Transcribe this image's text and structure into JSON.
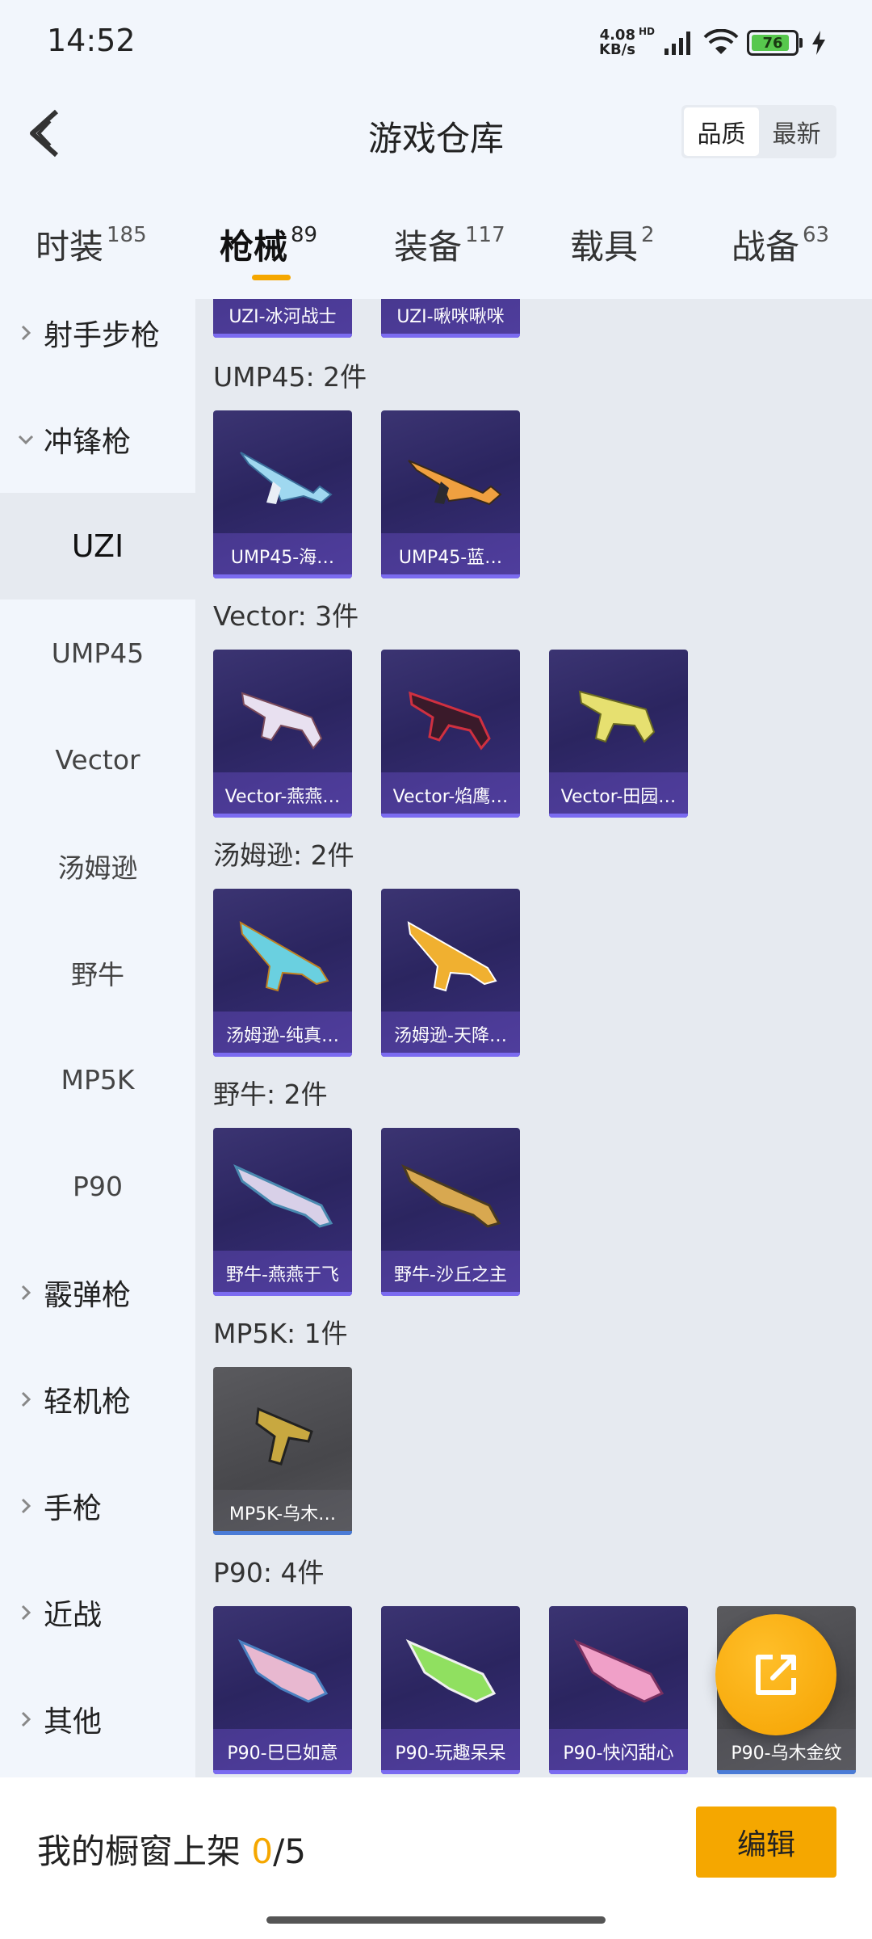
{
  "status_bar": {
    "time": "14:52",
    "net_speed_value": "4.08",
    "net_speed_unit": "KB/s",
    "hd_label": "HD",
    "battery": "76",
    "icons": [
      "signal-icon",
      "wifi-icon",
      "battery-icon",
      "charging-icon"
    ]
  },
  "header": {
    "title": "游戏仓库",
    "sort_options": [
      "品质",
      "最新"
    ],
    "active_sort": "品质"
  },
  "tabs": [
    {
      "label": "时装",
      "count": "185"
    },
    {
      "label": "枪械",
      "count": "89"
    },
    {
      "label": "装备",
      "count": "117"
    },
    {
      "label": "载具",
      "count": "2"
    },
    {
      "label": "战备",
      "count": "63"
    }
  ],
  "active_tab": "枪械",
  "sidebar": {
    "items": [
      {
        "label": "射手步枪",
        "type": "parent",
        "expanded": false
      },
      {
        "label": "冲锋枪",
        "type": "parent",
        "expanded": true
      },
      {
        "label": "UZI",
        "type": "sub",
        "selected": true
      },
      {
        "label": "UMP45",
        "type": "sub"
      },
      {
        "label": "Vector",
        "type": "sub"
      },
      {
        "label": "汤姆逊",
        "type": "sub"
      },
      {
        "label": "野牛",
        "type": "sub"
      },
      {
        "label": "MP5K",
        "type": "sub"
      },
      {
        "label": "P90",
        "type": "sub"
      },
      {
        "label": "霰弹枪",
        "type": "parent",
        "expanded": false
      },
      {
        "label": "轻机枪",
        "type": "parent",
        "expanded": false
      },
      {
        "label": "手枪",
        "type": "parent",
        "expanded": false
      },
      {
        "label": "近战",
        "type": "parent",
        "expanded": false
      },
      {
        "label": "其他",
        "type": "parent",
        "expanded": false
      }
    ]
  },
  "content": {
    "partial_top_cards": [
      "UZI-冰河战士",
      "UZI-啾咪啾咪"
    ],
    "groups": [
      {
        "title": "UMP45: 2件",
        "items": [
          "UMP45-海…",
          "UMP45-蓝…"
        ]
      },
      {
        "title": "Vector: 3件",
        "items": [
          "Vector-燕燕…",
          "Vector-焰鹰…",
          "Vector-田园…"
        ]
      },
      {
        "title": "汤姆逊: 2件",
        "items": [
          "汤姆逊-纯真…",
          "汤姆逊-天降…"
        ]
      },
      {
        "title": "野牛: 2件",
        "items": [
          "野牛-燕燕于飞",
          "野牛-沙丘之主"
        ]
      },
      {
        "title": "MP5K: 1件",
        "items": [
          "MP5K-乌木…"
        ]
      },
      {
        "title": "P90: 4件",
        "items": [
          "P90-巳巳如意",
          "P90-玩趣呆呆",
          "P90-快闪甜心",
          "P90-乌木金纹"
        ]
      }
    ]
  },
  "bottom": {
    "shelf_label": "我的橱窗上架",
    "shelf_current": "0",
    "shelf_total": "/5",
    "edit_label": "编辑"
  },
  "colors": {
    "accent": "#f5a700",
    "card_purple": "#2b2560",
    "card_grey": "#4a4a4e"
  }
}
